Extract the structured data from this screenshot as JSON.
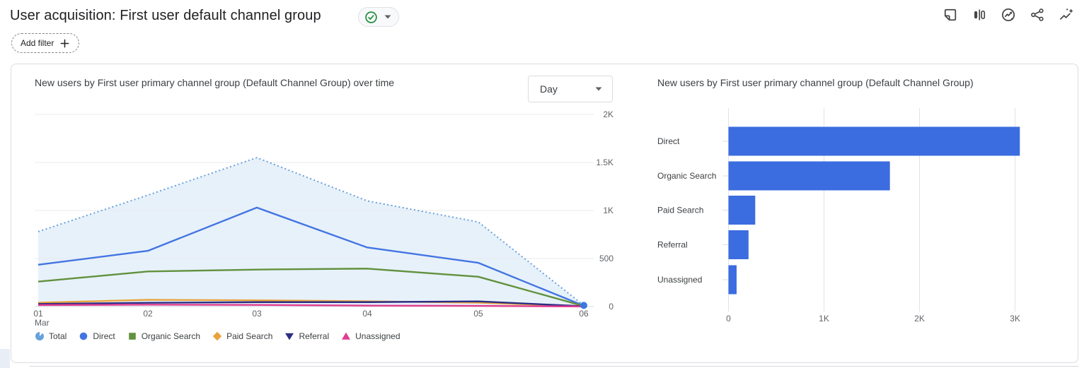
{
  "header": {
    "title": "User acquisition: First user default channel group",
    "status_badge": {
      "icon": "check-circle",
      "color": "#1e8e3e"
    },
    "add_filter_label": "Add filter",
    "toolbar_icons": [
      "note",
      "comparisons",
      "insights",
      "share",
      "analytics-intelligence"
    ]
  },
  "left_chart": {
    "title": "New users by First user primary channel group (Default Channel Group) over time",
    "granularity_value": "Day"
  },
  "right_chart": {
    "title": "New users by First user primary channel group (Default Channel Group)"
  },
  "chart_data": [
    {
      "type": "line",
      "title": "New users by First user primary channel group (Default Channel Group) over time",
      "granularity": "Day",
      "x": [
        "01",
        "02",
        "03",
        "04",
        "05",
        "06"
      ],
      "x_sub_label": "Mar",
      "ylim": [
        0,
        2000
      ],
      "y_ticks": [
        0,
        500,
        1000,
        1500,
        2000
      ],
      "y_tick_labels": [
        "0",
        "500",
        "1K",
        "1.5K",
        "2K"
      ],
      "grid": "horizontal",
      "legend_position": "bottom",
      "series": [
        {
          "name": "Total",
          "color": "#67a1db",
          "fill": "#e7f1fa",
          "line_style": "dotted",
          "marker": "scallop",
          "values": [
            780,
            1160,
            1550,
            1100,
            880,
            12
          ]
        },
        {
          "name": "Direct",
          "color": "#4375e2",
          "line_style": "solid",
          "marker": "circle",
          "values": [
            435,
            580,
            1030,
            615,
            455,
            8
          ]
        },
        {
          "name": "Organic Search",
          "color": "#61913d",
          "line_style": "solid",
          "marker": "square",
          "values": [
            260,
            365,
            385,
            395,
            310,
            5
          ]
        },
        {
          "name": "Paid Search",
          "color": "#e8a33d",
          "line_style": "solid",
          "marker": "diamond",
          "values": [
            40,
            70,
            65,
            55,
            40,
            2
          ]
        },
        {
          "name": "Referral",
          "color": "#2a2d86",
          "line_style": "solid",
          "marker": "triangle-down",
          "values": [
            27,
            39,
            46,
            46,
            54,
            3
          ]
        },
        {
          "name": "Unassigned",
          "color": "#e13c8f",
          "line_style": "solid",
          "marker": "triangle-up",
          "values": [
            15,
            20,
            17,
            10,
            7,
            1
          ]
        }
      ],
      "end_marker": {
        "at_x": "06",
        "color": "#3b77e0"
      }
    },
    {
      "type": "bar",
      "orientation": "horizontal",
      "title": "New users by First user primary channel group (Default Channel Group)",
      "categories": [
        "Direct",
        "Organic Search",
        "Paid Search",
        "Referral",
        "Unassigned"
      ],
      "values": [
        3050,
        1690,
        280,
        210,
        85
      ],
      "xlim": [
        0,
        3600
      ],
      "x_ticks": [
        0,
        1000,
        2000,
        3000
      ],
      "x_tick_labels": [
        "0",
        "1K",
        "2K",
        "3K"
      ],
      "bar_color": "#3b6ce0",
      "grid": "vertical"
    }
  ]
}
